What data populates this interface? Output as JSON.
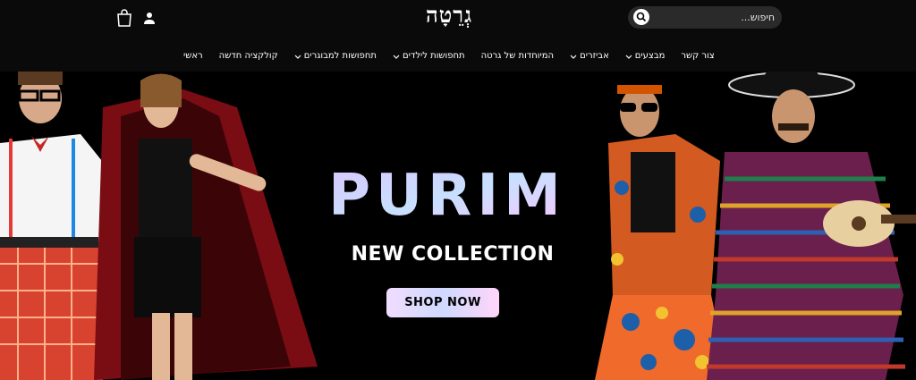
{
  "header": {
    "logo_text": "גְרֵטָה",
    "search": {
      "placeholder": "חיפוש...",
      "value": ""
    },
    "icons": {
      "cart": "shopping-bag-icon",
      "account": "user-icon",
      "search": "search-icon"
    }
  },
  "nav": {
    "items": [
      {
        "label": "ראשי",
        "has_dropdown": false
      },
      {
        "label": "קולקציה חדשה",
        "has_dropdown": false
      },
      {
        "label": "תחפושות למבוגרים",
        "has_dropdown": true
      },
      {
        "label": "תחפושות לילדים",
        "has_dropdown": true
      },
      {
        "label": "המיוחדות של גרטה",
        "has_dropdown": false
      },
      {
        "label": "אביזרים",
        "has_dropdown": true
      },
      {
        "label": "מבצעים",
        "has_dropdown": true
      },
      {
        "label": "צור קשר",
        "has_dropdown": false
      }
    ]
  },
  "hero": {
    "headline": "PURIM",
    "subheadline": "NEW COLLECTION",
    "cta_label": "SHOP NOW"
  },
  "colors": {
    "header_bg": "#0a0a0a",
    "search_bg": "#2a2a2a",
    "hero_bg": "#000000",
    "cta_gradient_start": "#f1ddff",
    "cta_gradient_end": "#ffd5f8"
  }
}
